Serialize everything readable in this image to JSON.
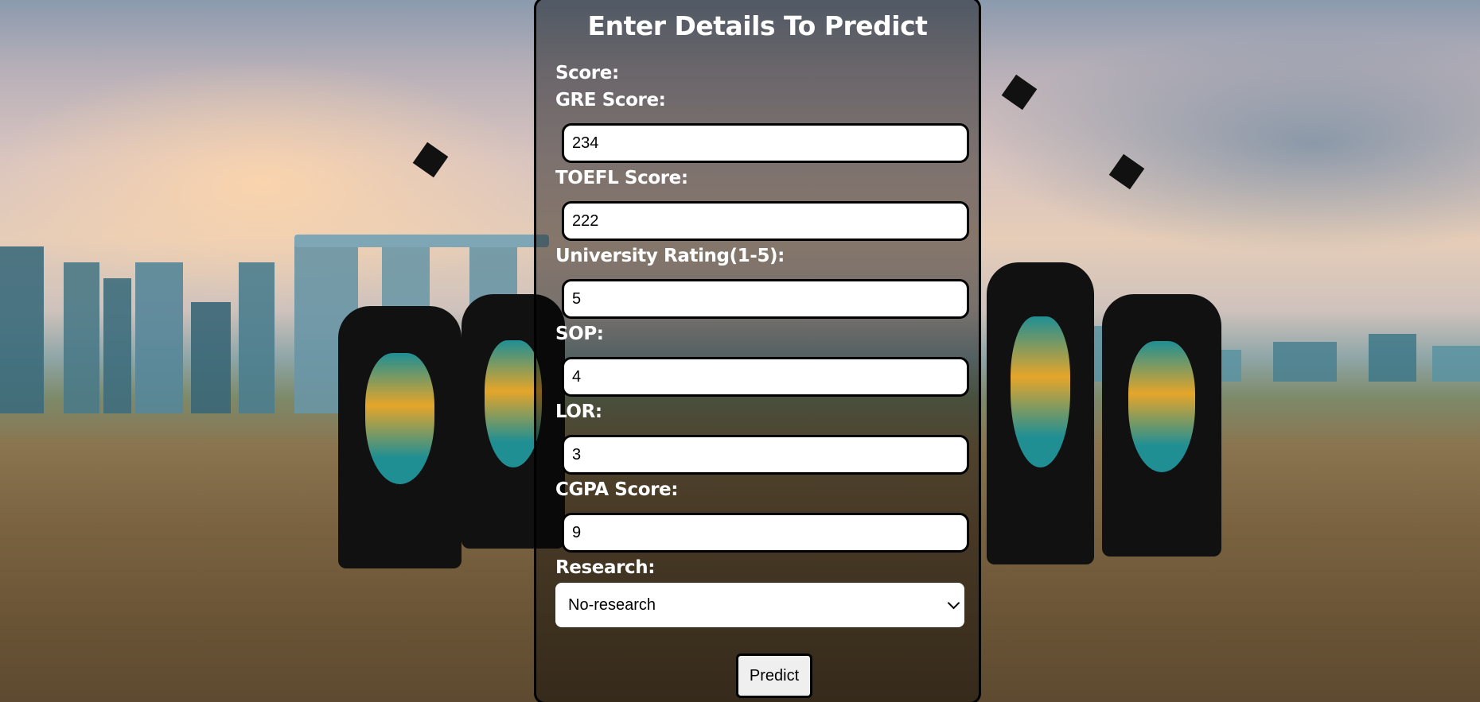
{
  "form": {
    "title": "Enter Details To Predict",
    "section_label": "Score:",
    "fields": [
      {
        "label": "GRE Score:",
        "value": "234"
      },
      {
        "label": "TOEFL Score:",
        "value": "222"
      },
      {
        "label": "University Rating(1-5):",
        "value": "5"
      },
      {
        "label": "SOP:",
        "value": "4"
      },
      {
        "label": "LOR:",
        "value": "3"
      },
      {
        "label": "CGPA Score:",
        "value": "9"
      }
    ],
    "research": {
      "label": "Research:",
      "selected": "No-research"
    },
    "submit_label": "Predict"
  },
  "colors": {
    "card_overlay": "#0000006b",
    "text": "#ffffff",
    "field_border": "#000000",
    "button_bg": "#efefef"
  }
}
